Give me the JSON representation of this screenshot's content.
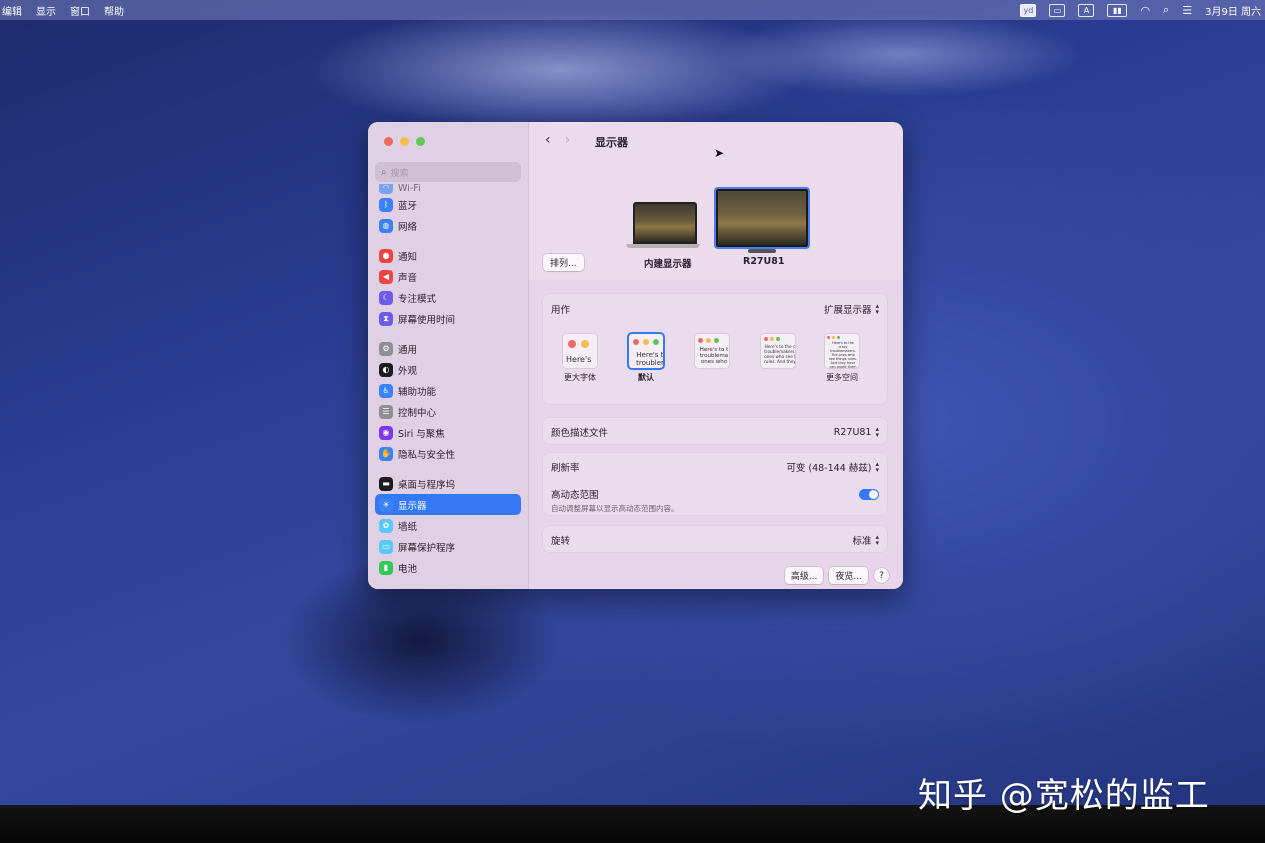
{
  "menubar": {
    "items": [
      "编辑",
      "显示",
      "窗口",
      "帮助"
    ],
    "status": {
      "yd_label": "yd",
      "input_label": "A",
      "date": "3月9日 周六"
    }
  },
  "watermark": "知乎 @宽松的监工",
  "window": {
    "search": {
      "placeholder": "搜索"
    },
    "sidebar": {
      "clipped_item": "Wi-Fi",
      "groups": [
        [
          {
            "label": "蓝牙",
            "icon": "bluetooth-icon",
            "color": "#3b82f6"
          },
          {
            "label": "网络",
            "icon": "network-globe-icon",
            "color": "#3b82f6"
          }
        ],
        [
          {
            "label": "通知",
            "icon": "notification-bell-icon",
            "color": "#ef4444"
          },
          {
            "label": "声音",
            "icon": "sound-speaker-icon",
            "color": "#ef4444"
          },
          {
            "label": "专注模式",
            "icon": "focus-moon-icon",
            "color": "#6d5ce7"
          },
          {
            "label": "屏幕使用时间",
            "icon": "hourglass-icon",
            "color": "#6d5ce7"
          }
        ],
        [
          {
            "label": "通用",
            "icon": "gear-icon",
            "color": "#8e8e93"
          },
          {
            "label": "外观",
            "icon": "appearance-icon",
            "color": "#1c1c1e"
          },
          {
            "label": "辅助功能",
            "icon": "accessibility-icon",
            "color": "#3b82f6"
          },
          {
            "label": "控制中心",
            "icon": "control-center-icon",
            "color": "#8e8e93"
          },
          {
            "label": "Siri 与聚焦",
            "icon": "siri-icon",
            "color": "#7c3aed"
          },
          {
            "label": "隐私与安全性",
            "icon": "privacy-hand-icon",
            "color": "#3b82f6"
          }
        ],
        [
          {
            "label": "桌面与程序坞",
            "icon": "desktop-dock-icon",
            "color": "#1c1c1e"
          },
          {
            "label": "显示器",
            "icon": "display-sun-icon",
            "color": "#3b82f6",
            "active": true
          },
          {
            "label": "墙纸",
            "icon": "wallpaper-icon",
            "color": "#5ac8fa"
          },
          {
            "label": "屏幕保护程序",
            "icon": "screensaver-icon",
            "color": "#5ac8fa"
          },
          {
            "label": "电池",
            "icon": "battery-icon",
            "color": "#34c759"
          }
        ]
      ]
    },
    "main": {
      "title": "显示器",
      "arrange_button": "排列...",
      "displays": [
        {
          "label": "内建显示器"
        },
        {
          "label": "R27U81",
          "selected": true
        }
      ],
      "use_as": {
        "label": "用作",
        "value": "扩展显示器"
      },
      "resolutions": [
        {
          "caption": "更大字体",
          "text": "Here's",
          "selected": false
        },
        {
          "caption": "默认",
          "text": "Here's to troublem",
          "selected": true
        },
        {
          "caption": "",
          "text": "Here's to t troublema ones who",
          "selected": false
        },
        {
          "caption": "",
          "text": "Here's to the c troublemakers. ones who see t rules. And they",
          "selected": false
        },
        {
          "caption": "更多空间",
          "text": "Here's to the crazy troublemakers. The ones who see things rules. And they have can quote them",
          "selected": false
        }
      ],
      "color_profile": {
        "label": "颜色描述文件",
        "value": "R27U81"
      },
      "refresh_rate": {
        "label": "刷新率",
        "value": "可变 (48-144 赫兹)"
      },
      "hdr": {
        "label": "高动态范围",
        "sub": "自动调整屏幕以显示高动态范围内容。",
        "on": true
      },
      "rotation": {
        "label": "旋转",
        "value": "标准"
      },
      "buttons": {
        "advanced": "高级...",
        "night_shift": "夜览...",
        "help": "?"
      }
    }
  }
}
